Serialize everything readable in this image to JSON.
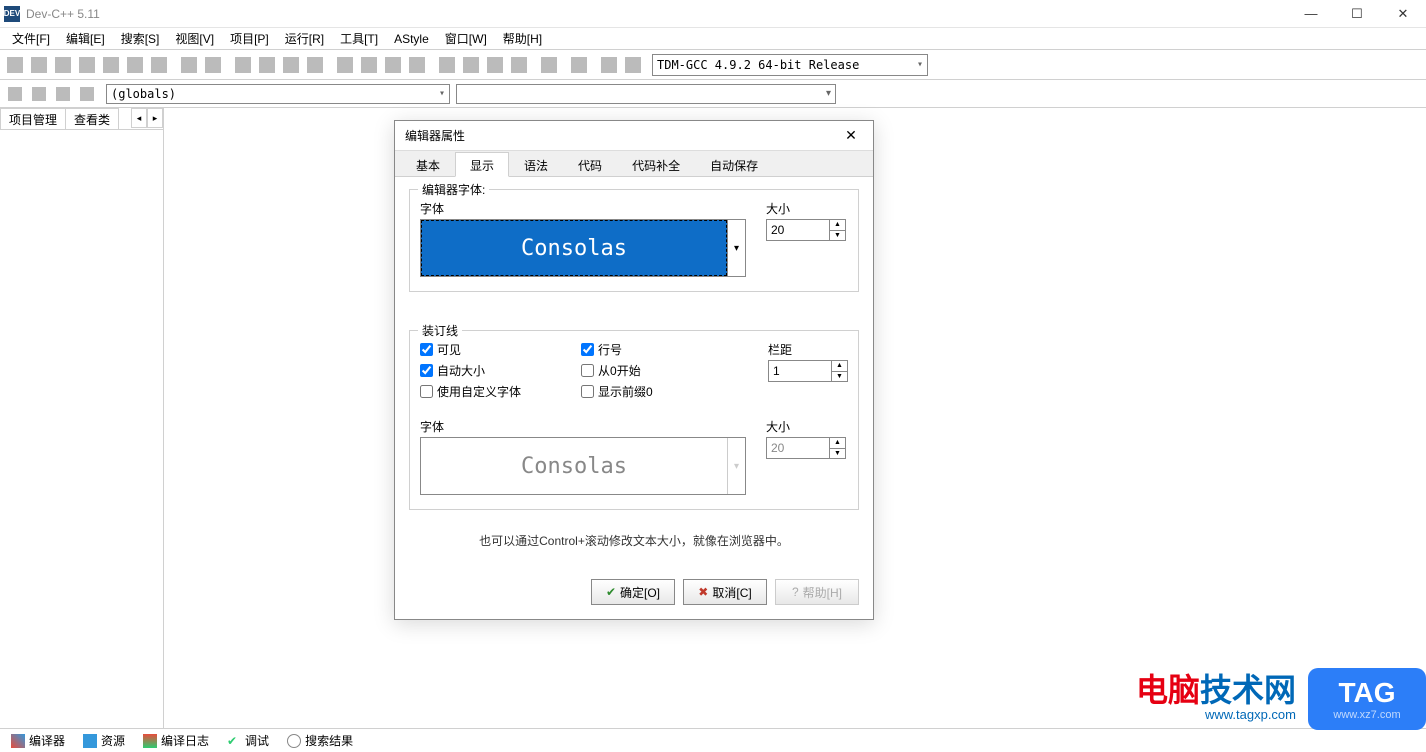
{
  "titlebar": {
    "title": "Dev-C++ 5.11"
  },
  "menu": {
    "file": "文件[F]",
    "edit": "编辑[E]",
    "search": "搜索[S]",
    "view": "视图[V]",
    "project": "项目[P]",
    "run": "运行[R]",
    "tools": "工具[T]",
    "astyle": "AStyle",
    "window": "窗口[W]",
    "help": "帮助[H]"
  },
  "toolbar": {
    "compiler": "TDM-GCC 4.9.2 64-bit Release"
  },
  "toolbar2": {
    "globals": "(globals)"
  },
  "sidebar": {
    "tab_project": "项目管理",
    "tab_class": "查看类"
  },
  "bottom": {
    "compiler": "编译器",
    "resource": "资源",
    "compile_log": "编译日志",
    "debug": "调试",
    "search_results": "搜索结果"
  },
  "dialog": {
    "title": "编辑器属性",
    "tabs": {
      "basic": "基本",
      "display": "显示",
      "syntax": "语法",
      "code": "代码",
      "completion": "代码补全",
      "autosave": "自动保存"
    },
    "font_section": {
      "legend": "编辑器字体:",
      "font_label": "字体",
      "font_value": "Consolas",
      "size_label": "大小",
      "size_value": "20"
    },
    "gutter_section": {
      "legend": "装订线",
      "visible": "可见",
      "auto_size": "自动大小",
      "custom_font": "使用自定义字体",
      "line_no": "行号",
      "from_zero": "从0开始",
      "show_prefix": "显示前缀0",
      "margin_label": "栏距",
      "margin_value": "1",
      "font_label": "字体",
      "font_value": "Consolas",
      "size_label": "大小",
      "size_value": "20"
    },
    "hint": "也可以通过Control+滚动修改文本大小，就像在浏览器中。",
    "buttons": {
      "ok": "确定[O]",
      "cancel": "取消[C]",
      "help": "帮助[H]"
    }
  },
  "watermark": {
    "text1": "电脑",
    "text2": "技术网",
    "sub": "www.tagxp.com",
    "tag": "TAG",
    "tagsub": "www.xz7.com"
  }
}
